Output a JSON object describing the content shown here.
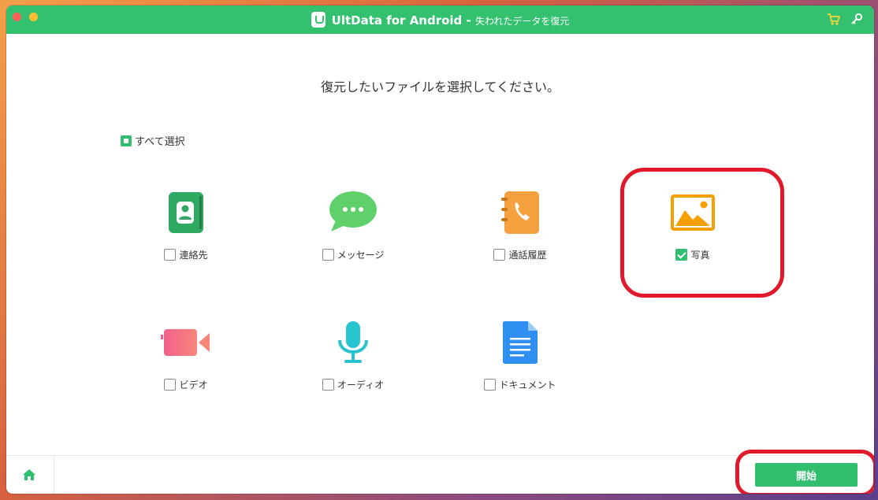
{
  "window": {
    "title_main": "UltData for Android",
    "title_separator": " - ",
    "title_sub": "失われたデータを復元"
  },
  "main": {
    "instruction": "復元したいファイルを選択してください。",
    "select_all_label": "すべて選択",
    "file_types": [
      {
        "label": "連絡先",
        "icon": "contacts-icon",
        "checked": false
      },
      {
        "label": "メッセージ",
        "icon": "messages-icon",
        "checked": false
      },
      {
        "label": "通話履歴",
        "icon": "call-history-icon",
        "checked": false
      },
      {
        "label": "写真",
        "icon": "photo-icon",
        "checked": true
      },
      {
        "label": "ビデオ",
        "icon": "video-icon",
        "checked": false
      },
      {
        "label": "オーディオ",
        "icon": "audio-icon",
        "checked": false
      },
      {
        "label": "ドキュメント",
        "icon": "document-icon",
        "checked": false
      }
    ]
  },
  "footer": {
    "start_label": "開始"
  },
  "colors": {
    "brand_green": "#33c06f",
    "annotation_red": "#e01a2b"
  }
}
